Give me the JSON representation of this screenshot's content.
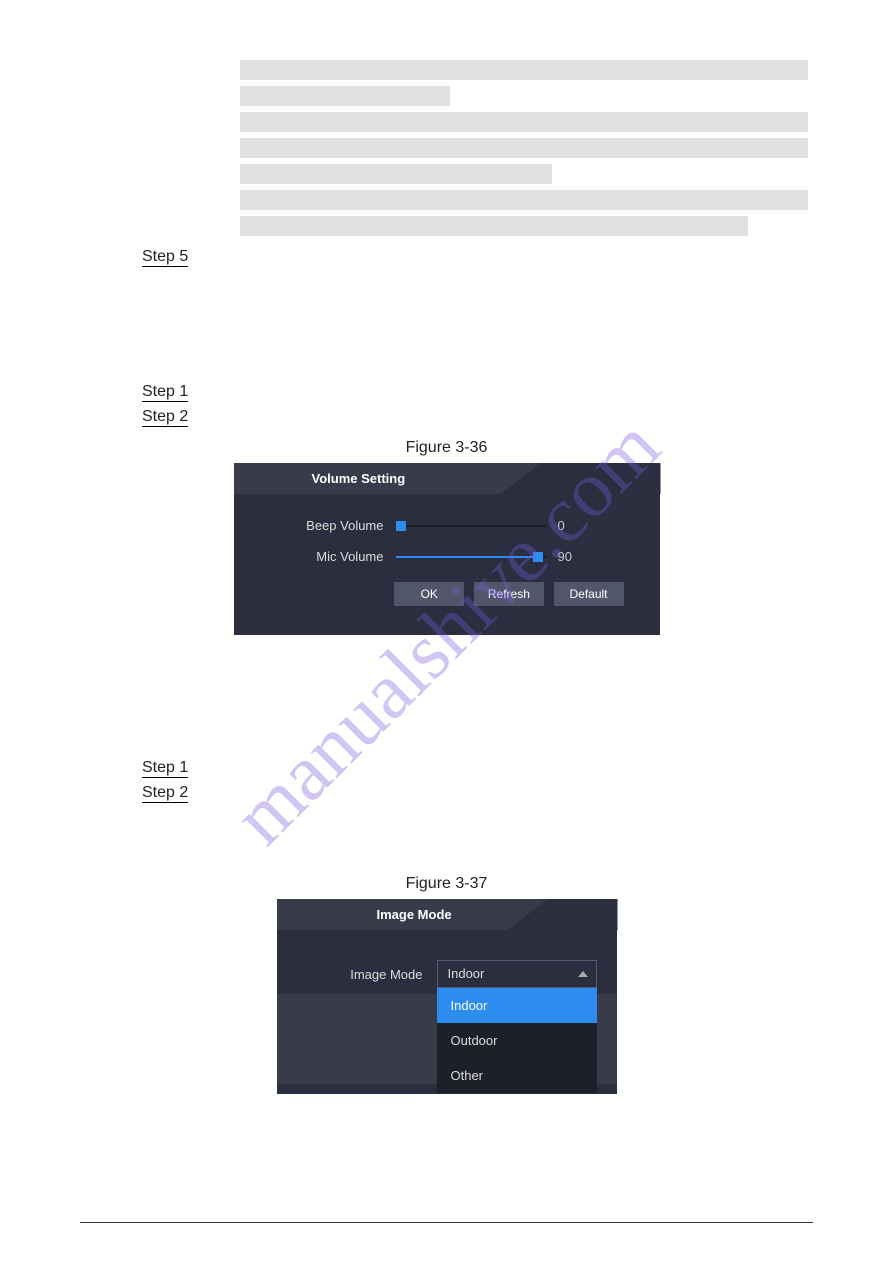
{
  "watermark": "manualshive.com",
  "steps_block1": {
    "step5": "Step 5"
  },
  "steps_block2": {
    "step1": "Step 1",
    "step2": "Step 2"
  },
  "steps_block3": {
    "step1": "Step 1",
    "step2": "Step 2"
  },
  "figure36": {
    "caption": "Figure 3-36",
    "title": "Volume Setting",
    "rows": {
      "beep": {
        "label": "Beep Volume",
        "value": "0",
        "percent": 0
      },
      "mic": {
        "label": "Mic Volume",
        "value": "90",
        "percent": 95
      }
    },
    "buttons": {
      "ok": "OK",
      "refresh": "Refresh",
      "default": "Default"
    }
  },
  "figure37": {
    "caption": "Figure 3-37",
    "title": "Image Mode",
    "label": "Image Mode",
    "selected": "Indoor",
    "options": [
      "Indoor",
      "Outdoor",
      "Other"
    ]
  },
  "redact_widths": [
    568,
    210,
    568,
    568,
    312,
    568,
    508
  ]
}
